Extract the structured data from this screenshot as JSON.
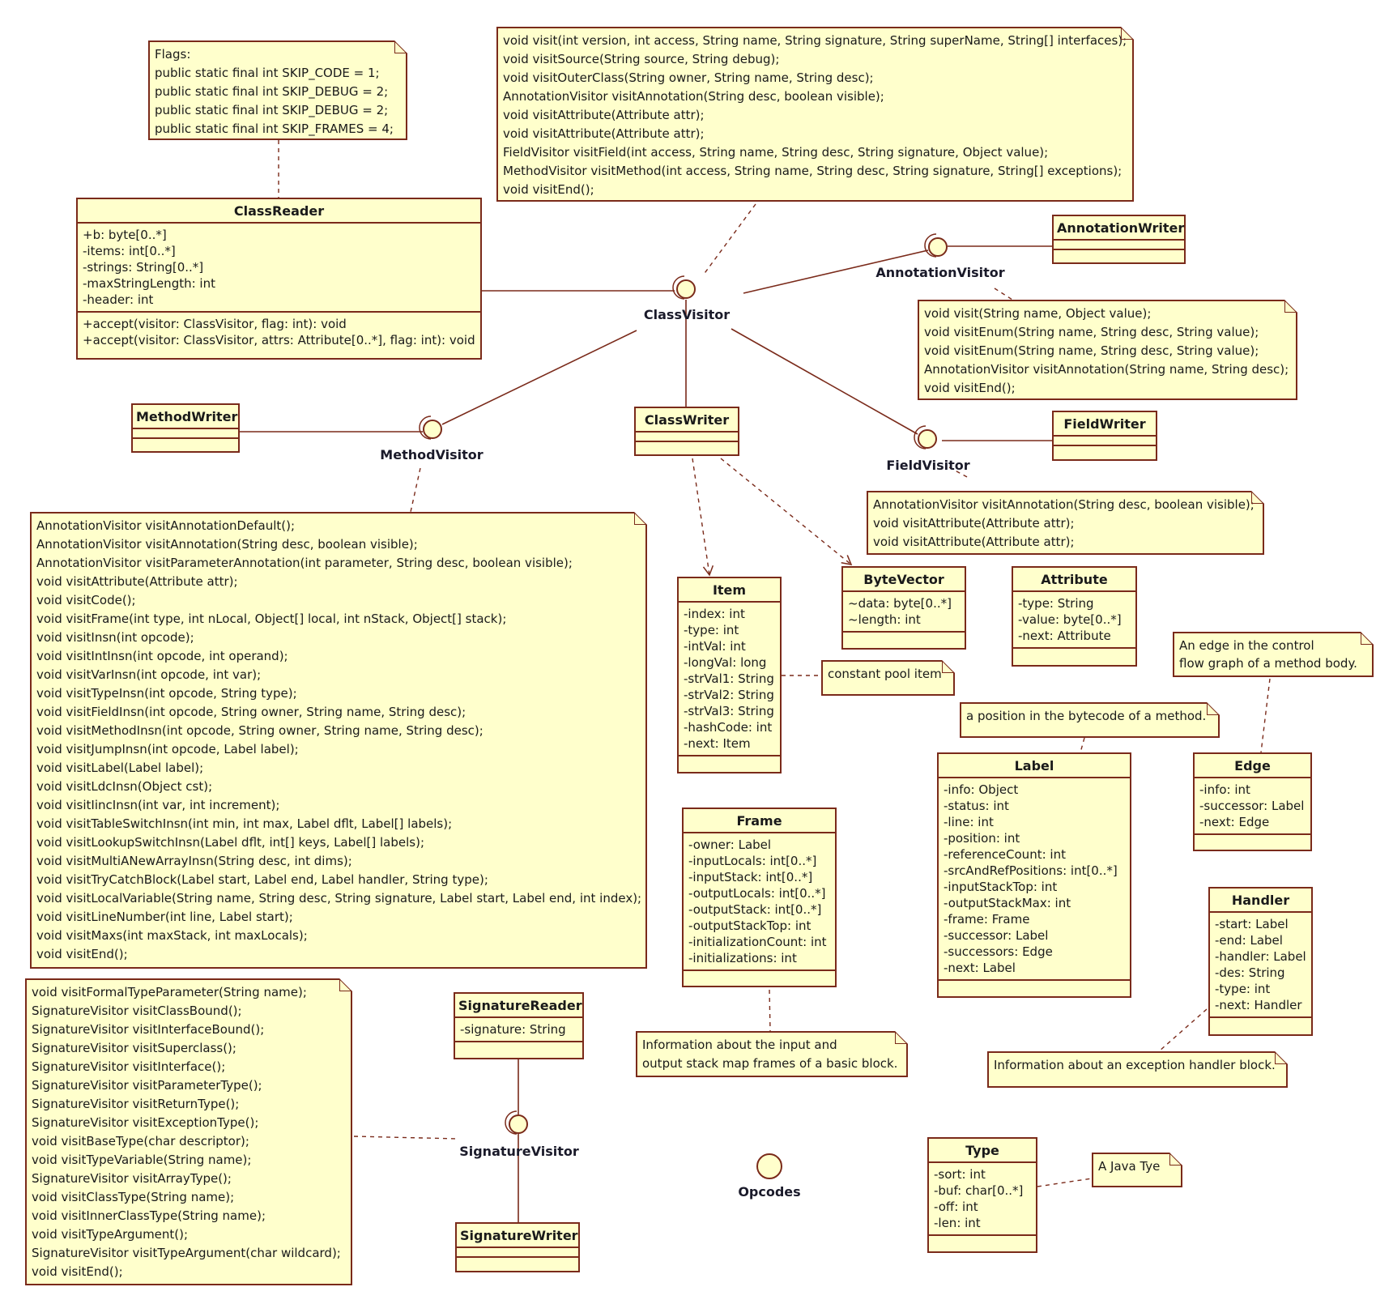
{
  "colors": {
    "fill": "#ffffcc",
    "border": "#7a2a1a",
    "line": "#7a2a1a",
    "text": "#1a1a1a"
  },
  "interfaces": {
    "class_visitor": "ClassVisitor",
    "annotation_visitor": "AnnotationVisitor",
    "method_visitor": "MethodVisitor",
    "field_visitor": "FieldVisitor",
    "signature_visitor": "SignatureVisitor",
    "opcodes": "Opcodes"
  },
  "classes": {
    "class_reader": {
      "name": "ClassReader",
      "attributes": [
        "+b: byte[0..*]",
        "-items: int[0..*]",
        "-strings: String[0..*]",
        "-maxStringLength: int",
        "-header: int"
      ],
      "operations": [
        "+accept(visitor: ClassVisitor, flag: int): void",
        "+accept(visitor: ClassVisitor, attrs: Attribute[0..*], flag: int): void"
      ]
    },
    "annotation_writer": {
      "name": "AnnotationWriter"
    },
    "method_writer": {
      "name": "MethodWriter"
    },
    "class_writer": {
      "name": "ClassWriter"
    },
    "field_writer": {
      "name": "FieldWriter"
    },
    "item": {
      "name": "Item",
      "attributes": [
        "-index: int",
        "-type: int",
        "-intVal: int",
        "-longVal: long",
        "-strVal1: String",
        "-strVal2: String",
        "-strVal3: String",
        "-hashCode: int",
        "-next: Item"
      ]
    },
    "byte_vector": {
      "name": "ByteVector",
      "attributes": [
        "~data: byte[0..*]",
        "~length: int"
      ]
    },
    "attribute": {
      "name": "Attribute",
      "attributes": [
        "-type: String",
        "-value: byte[0..*]",
        "-next: Attribute"
      ]
    },
    "label": {
      "name": "Label",
      "attributes": [
        "-info: Object",
        "-status: int",
        "-line: int",
        "-position: int",
        "-referenceCount: int",
        "-srcAndRefPositions: int[0..*]",
        "-inputStackTop: int",
        "-outputStackMax: int",
        "-frame: Frame",
        "-successor: Label",
        "-successors: Edge",
        "-next: Label"
      ]
    },
    "edge": {
      "name": "Edge",
      "attributes": [
        "-info: int",
        "-successor: Label",
        "-next: Edge"
      ]
    },
    "frame": {
      "name": "Frame",
      "attributes": [
        "-owner: Label",
        "-inputLocals: int[0..*]",
        "-inputStack: int[0..*]",
        "-outputLocals: int[0..*]",
        "-outputStack: int[0..*]",
        "-outputStackTop: int",
        "-initializationCount: int",
        "-initializations: int"
      ]
    },
    "handler": {
      "name": "Handler",
      "attributes": [
        "-start: Label",
        "-end: Label",
        "-handler: Label",
        "-des: String",
        "-type: int",
        "-next: Handler"
      ]
    },
    "signature_reader": {
      "name": "SignatureReader",
      "attributes": [
        "-signature: String"
      ]
    },
    "signature_writer": {
      "name": "SignatureWriter"
    },
    "type": {
      "name": "Type",
      "attributes": [
        "-sort: int",
        "-buf: char[0..*]",
        "-off: int",
        "-len: int"
      ]
    }
  },
  "notes": {
    "flags": [
      "Flags:",
      "public static final int SKIP_CODE = 1;",
      "public static final int SKIP_DEBUG = 2;",
      "public static final int SKIP_DEBUG = 2;",
      "public static final int SKIP_FRAMES = 4;"
    ],
    "class_visitor": [
      "void visit(int version, int access, String name, String signature, String superName, String[] interfaces);",
      "void visitSource(String source, String debug);",
      "void visitOuterClass(String owner, String name, String desc);",
      "AnnotationVisitor visitAnnotation(String desc, boolean visible);",
      "void visitAttribute(Attribute attr);",
      "void visitAttribute(Attribute attr);",
      "FieldVisitor visitField(int access, String name, String desc, String signature, Object value);",
      "MethodVisitor visitMethod(int access, String name, String desc, String signature, String[] exceptions);",
      "void visitEnd();"
    ],
    "annotation_visitor": [
      "void visit(String name, Object value);",
      "void visitEnum(String name, String desc, String value);",
      "void visitEnum(String name, String desc, String value);",
      "AnnotationVisitor visitAnnotation(String name, String desc);",
      "void visitEnd();"
    ],
    "field_visitor": [
      "AnnotationVisitor visitAnnotation(String desc, boolean visible);",
      "void visitAttribute(Attribute attr);",
      "void visitAttribute(Attribute attr);"
    ],
    "method_visitor": [
      "AnnotationVisitor visitAnnotationDefault();",
      "AnnotationVisitor visitAnnotation(String desc, boolean visible);",
      "AnnotationVisitor visitParameterAnnotation(int parameter, String desc, boolean visible);",
      "void visitAttribute(Attribute attr);",
      "void visitCode();",
      "void visitFrame(int type, int nLocal, Object[] local, int nStack, Object[] stack);",
      "void visitInsn(int opcode);",
      "void visitIntInsn(int opcode, int operand);",
      "void visitVarInsn(int opcode, int var);",
      "void visitTypeInsn(int opcode, String type);",
      "void visitFieldInsn(int opcode, String owner, String name, String desc);",
      "void visitMethodInsn(int opcode, String owner, String name, String desc);",
      "void visitJumpInsn(int opcode, Label label);",
      "void visitLabel(Label label);",
      "void visitLdcInsn(Object cst);",
      "void visitIincInsn(int var, int increment);",
      "void visitTableSwitchInsn(int min, int max, Label dflt, Label[] labels);",
      "void visitLookupSwitchInsn(Label dflt, int[] keys, Label[] labels);",
      "void visitMultiANewArrayInsn(String desc, int dims);",
      "void visitTryCatchBlock(Label start, Label end, Label handler, String type);",
      "void visitLocalVariable(String name, String desc, String signature, Label start, Label end, int index);",
      "void visitLineNumber(int line, Label start);",
      "void visitMaxs(int maxStack, int maxLocals);",
      "void visitEnd();"
    ],
    "signature_visitor": [
      "void visitFormalTypeParameter(String name);",
      "SignatureVisitor visitClassBound();",
      "SignatureVisitor visitInterfaceBound();",
      "SignatureVisitor visitSuperclass();",
      "SignatureVisitor visitInterface();",
      "SignatureVisitor visitParameterType();",
      "SignatureVisitor visitReturnType();",
      "SignatureVisitor visitExceptionType();",
      "void visitBaseType(char descriptor);",
      "void visitTypeVariable(String name);",
      "SignatureVisitor visitArrayType();",
      "void visitClassType(String name);",
      "void visitInnerClassType(String name);",
      "void visitTypeArgument();",
      "SignatureVisitor visitTypeArgument(char wildcard);",
      "void visitEnd();"
    ],
    "item": [
      "constant pool item"
    ],
    "edge": [
      "An edge in the control",
      "flow graph of a method body."
    ],
    "label": [
      "a position in the bytecode of a method."
    ],
    "frame": [
      "Information about the input and",
      "output stack map frames of a basic block."
    ],
    "handler": [
      "Information about an exception handler block."
    ],
    "type": [
      "A Java Tye"
    ]
  }
}
